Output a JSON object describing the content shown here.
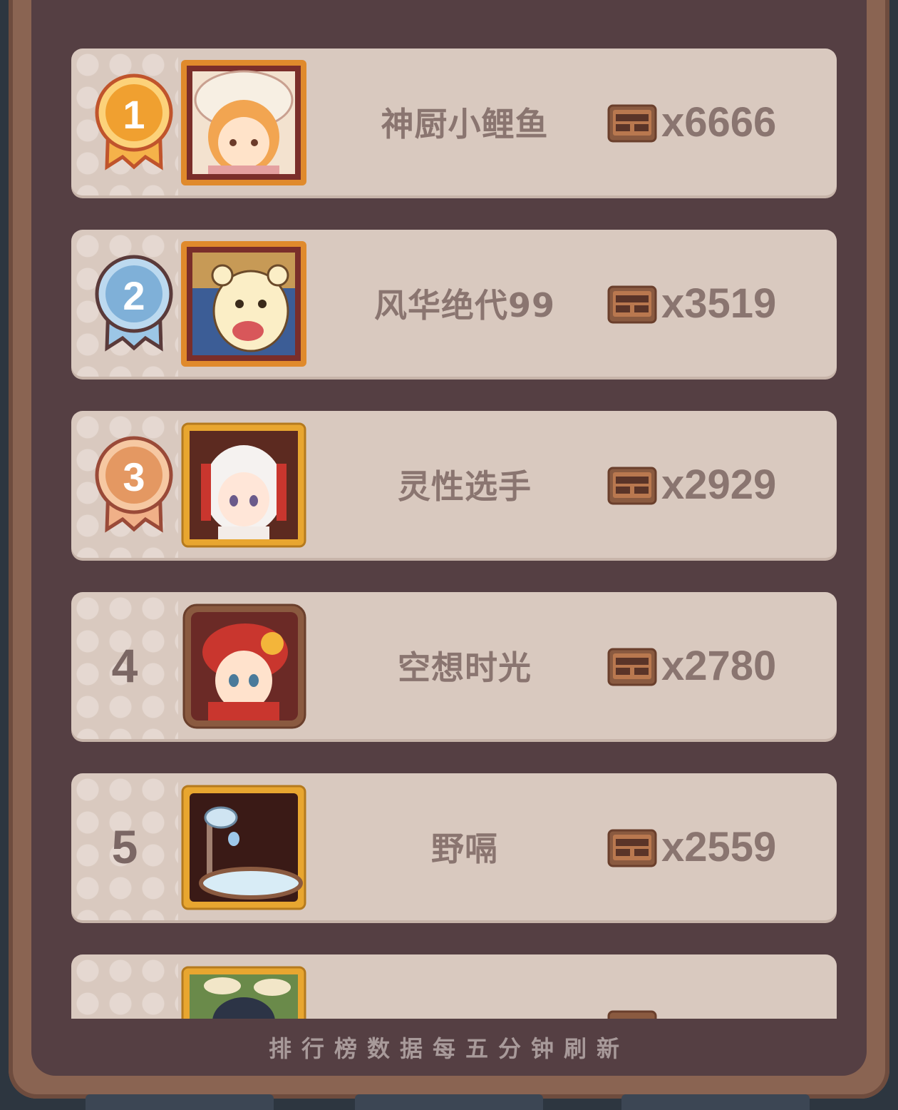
{
  "leaderboard": {
    "entries": [
      {
        "rank": "1",
        "name": "神厨小鲤鱼",
        "score": "x6666",
        "medal": "gold-medal"
      },
      {
        "rank": "2",
        "name": "风华绝代99",
        "score": "x3519",
        "medal": "silver-medal"
      },
      {
        "rank": "3",
        "name": "灵性选手",
        "score": "x2929",
        "medal": "bronze-medal"
      },
      {
        "rank": "4",
        "name": "空想时光",
        "score": "x2780"
      },
      {
        "rank": "5",
        "name": "野嗝",
        "score": "x2559"
      }
    ],
    "footer_note": "排行榜数据每五分钟刷新"
  },
  "colors": {
    "panel": "#553f43",
    "row": "#d9c9bf",
    "text": "#8a7570",
    "gold": "#f0a030",
    "silver": "#7fb0d8",
    "bronze": "#e49862"
  }
}
